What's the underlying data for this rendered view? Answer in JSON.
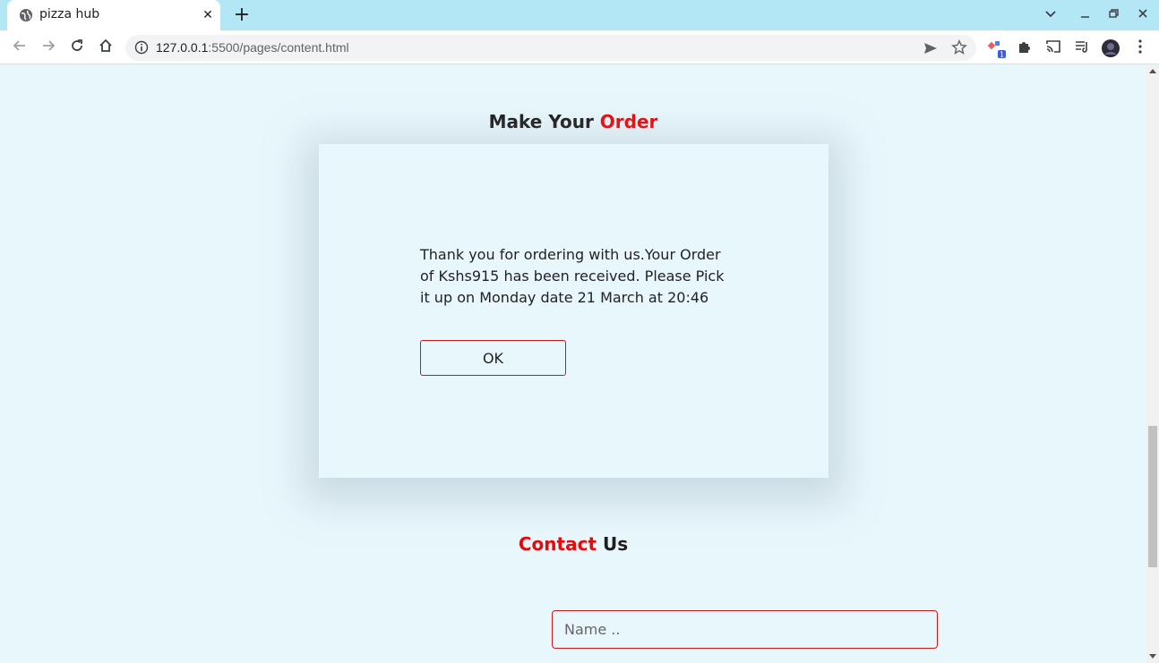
{
  "browser": {
    "tab": {
      "title": "pizza hub",
      "close_glyph": "✕"
    },
    "new_tab_glyph": "+",
    "url": {
      "host": "127.0.0.1",
      "path": ":5500/pages/content.html"
    },
    "extension_badge": "1"
  },
  "page": {
    "order_heading": {
      "part1": "Make Your ",
      "part2": "Order"
    },
    "dialog": {
      "message": "Thank you for ordering with us.Your Order of Kshs915 has been received. Please Pick it up on Monday date 21 March at 20:46",
      "ok_label": "OK"
    },
    "contact_heading": {
      "part1": "Contact",
      "part2": " Us"
    },
    "name_field": {
      "placeholder": "Name .."
    }
  },
  "colors": {
    "accent": "#e30b0b",
    "page_bg": "#e8f7fc",
    "tab_strip": "#b3e7f5"
  }
}
